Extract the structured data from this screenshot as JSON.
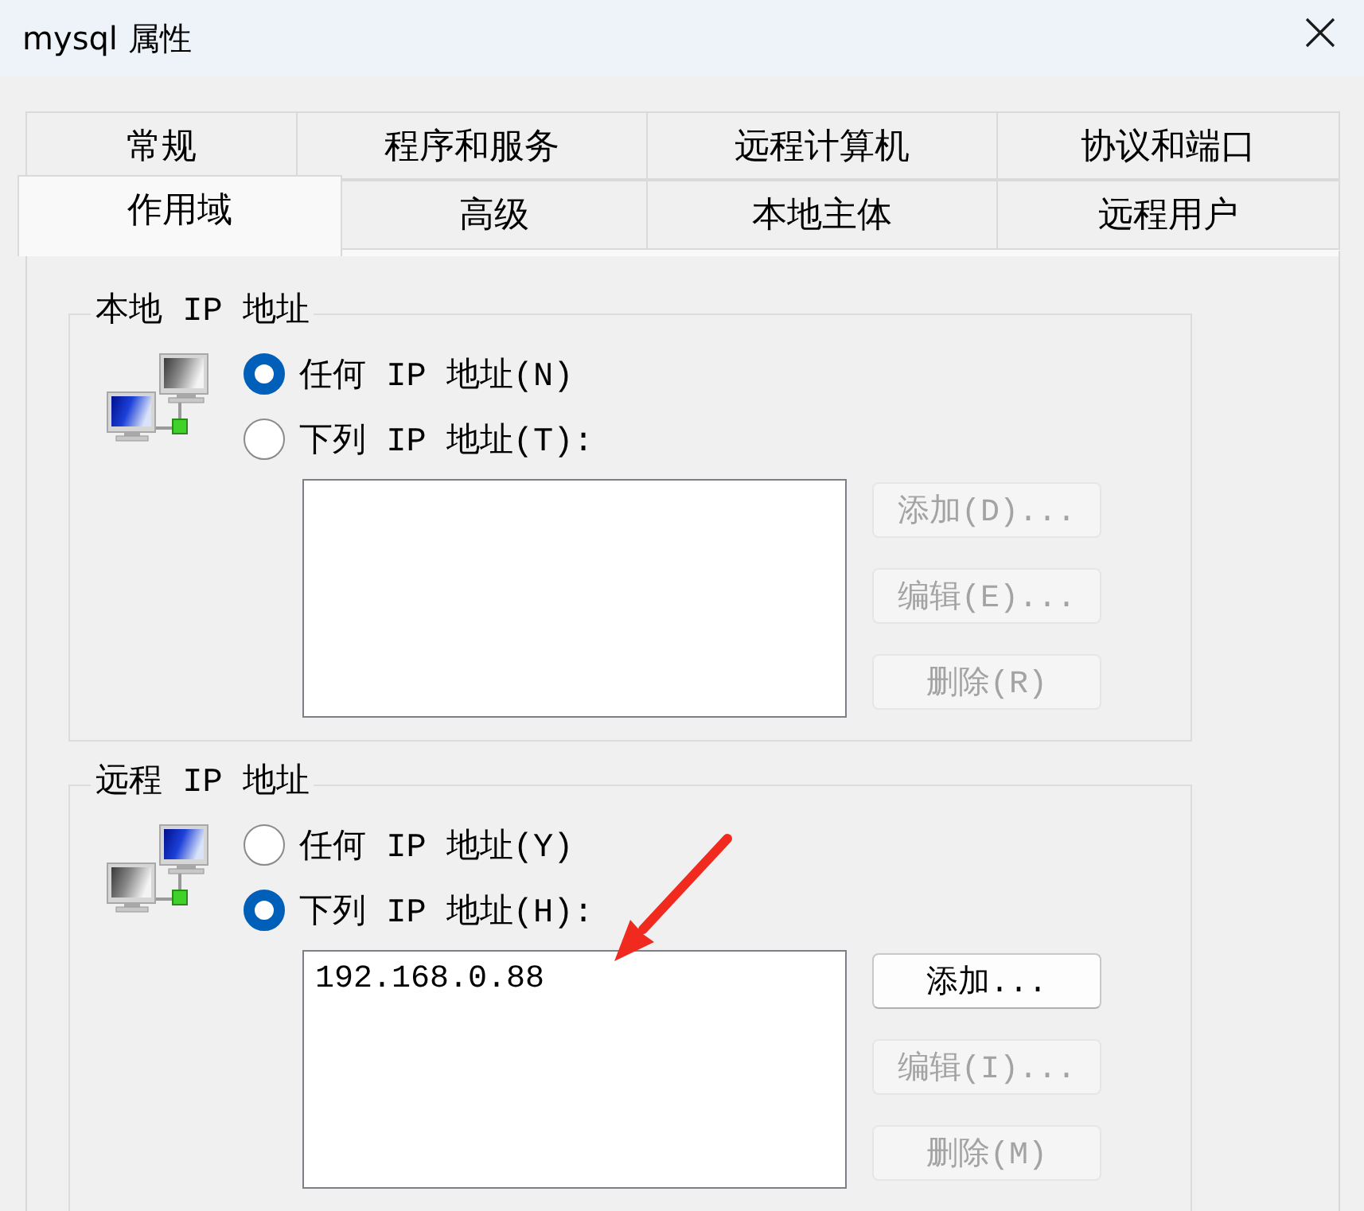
{
  "window": {
    "title": "mysql 属性"
  },
  "tab_rows": [
    {
      "tabs": [
        {
          "label": "常规",
          "selected": false
        },
        {
          "label": "程序和服务",
          "selected": false
        },
        {
          "label": "远程计算机",
          "selected": false
        },
        {
          "label": "协议和端口",
          "selected": false
        }
      ]
    },
    {
      "tabs": [
        {
          "label": "作用域",
          "selected": true
        },
        {
          "label": "高级",
          "selected": false
        },
        {
          "label": "本地主体",
          "selected": false
        },
        {
          "label": "远程用户",
          "selected": false
        }
      ]
    }
  ],
  "groups": [
    {
      "kind": "local",
      "legend": "本地 IP 地址",
      "options": [
        {
          "label": "任何 IP 地址(N)",
          "selected": true
        },
        {
          "label": "下列 IP 地址(T):",
          "selected": false
        }
      ],
      "buttons": [
        {
          "label": "添加(D)...",
          "disabled": true
        },
        {
          "label": "编辑(E)...",
          "disabled": true
        },
        {
          "label": "删除(R)",
          "disabled": true
        }
      ]
    },
    {
      "kind": "remote",
      "legend": "远程 IP 地址",
      "options": [
        {
          "label": "任何 IP 地址(Y)",
          "selected": false
        },
        {
          "label": "下列 IP 地址(H):",
          "selected": true
        }
      ],
      "addresses": [
        "192.168.0.88"
      ],
      "buttons": [
        {
          "label": "添加...",
          "disabled": false
        },
        {
          "label": "编辑(I)...",
          "disabled": true
        },
        {
          "label": "删除(M)",
          "disabled": true
        }
      ]
    }
  ],
  "annotations": [
    {
      "kind": "arrow"
    }
  ]
}
